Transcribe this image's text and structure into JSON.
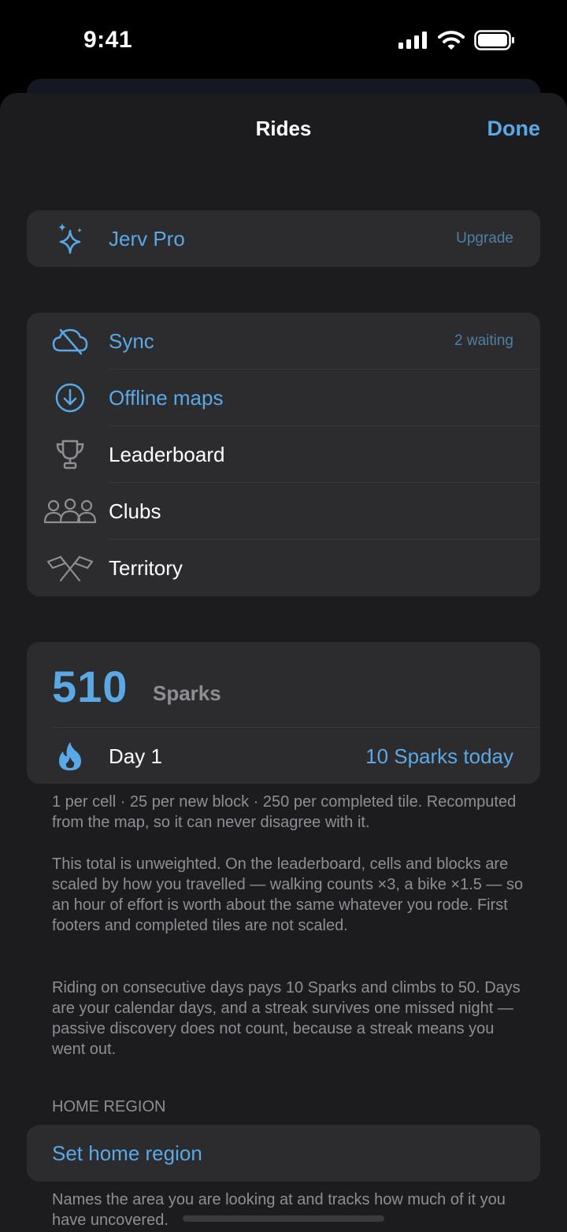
{
  "status": {
    "time": "9:41"
  },
  "nav": {
    "title": "Rides",
    "done": "Done"
  },
  "pro": {
    "label": "Jerv Pro",
    "detail": "Upgrade"
  },
  "menu": [
    {
      "label": "Sync",
      "detail": "2 waiting",
      "icon": "cloud-off-icon",
      "tone": "blue"
    },
    {
      "label": "Offline maps",
      "detail": "",
      "icon": "download-circle-icon",
      "tone": "blue"
    },
    {
      "label": "Leaderboard",
      "detail": "",
      "icon": "trophy-icon",
      "tone": "white"
    },
    {
      "label": "Clubs",
      "detail": "",
      "icon": "people-icon",
      "tone": "white"
    },
    {
      "label": "Territory",
      "detail": "",
      "icon": "crossed-flags-icon",
      "tone": "white"
    }
  ],
  "sparks": {
    "value": "510",
    "unit": "Sparks",
    "streak_label": "Day 1",
    "today": "10 Sparks today"
  },
  "notes": {
    "p1": "1 per cell · 25 per new block · 250 per completed tile. Recomputed from the map, so it can never disagree with it.",
    "p2": "This total is unweighted. On the leaderboard, cells and blocks are scaled by how you travelled — walking counts ×3, a bike ×1.5 — so an hour of effort is worth about the same whatever you rode. First footers and completed tiles are not scaled.",
    "p3": "Riding on consecutive days pays 10 Sparks and climbs to 50. Days are your calendar days, and a streak survives one missed night — passive discovery does not count, because a streak means you went out."
  },
  "home_region": {
    "header": "HOME REGION",
    "button": "Set home region",
    "footer": "Names the area you are looking at and tracks how much of it you have uncovered."
  },
  "colors": {
    "accent": "#5aa8e6",
    "background": "#1c1c1e",
    "cell": "#2c2c2e",
    "secondary": "#8e8e93"
  }
}
